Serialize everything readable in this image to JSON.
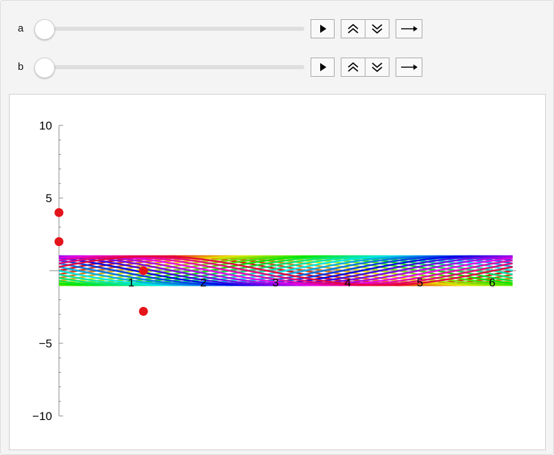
{
  "controls": {
    "sliders": [
      {
        "label": "a",
        "value": 0
      },
      {
        "label": "b",
        "value": 0
      }
    ],
    "buttons": [
      "play-icon",
      "faster-icon",
      "slower-icon",
      "direction-icon"
    ]
  },
  "chart_data": {
    "type": "line",
    "title": "",
    "xlabel": "",
    "ylabel": "",
    "xlim": [
      0,
      6.283
    ],
    "ylim": [
      -10,
      10
    ],
    "x_ticks": [
      1,
      2,
      3,
      4,
      5,
      6
    ],
    "x_tick_labels": [
      "1",
      "2",
      "3",
      "4",
      "5",
      "6"
    ],
    "y_ticks": [
      -10,
      -5,
      5,
      10
    ],
    "y_tick_labels": [
      "−10",
      "−5",
      "5",
      "10"
    ],
    "curve_family": {
      "description_formula": "y = sin(x - phase)",
      "amplitude": 1,
      "phases_count": 24,
      "color_hue_cycle": true
    },
    "points": [
      {
        "x": 0,
        "y": 4,
        "color": "#e4141b"
      },
      {
        "x": 0,
        "y": 2,
        "color": "#e4141b"
      },
      {
        "x": 1.17,
        "y": 0,
        "color": "#e4141b"
      },
      {
        "x": 1.17,
        "y": -2.8,
        "color": "#e4141b"
      }
    ],
    "grid": false,
    "legend": "none"
  }
}
